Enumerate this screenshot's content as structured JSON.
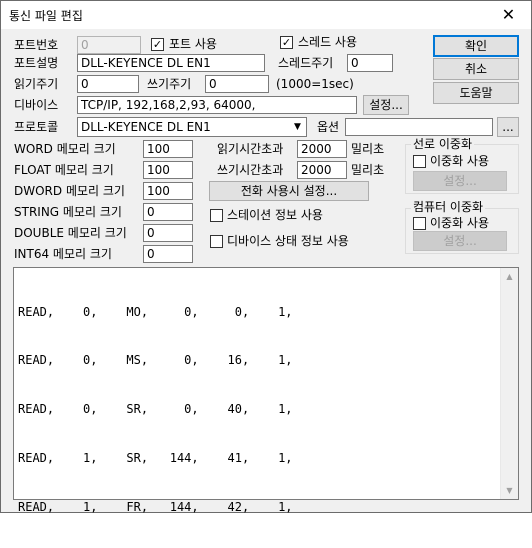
{
  "window": {
    "title": "통신 파일 편집",
    "close_glyph": "✕"
  },
  "port": {
    "number_label": "포트번호",
    "number_value": "0",
    "use_port_label": "포트 사용",
    "use_port_checked": "✓",
    "use_thread_label": "스레드 사용",
    "use_thread_checked": "✓",
    "desc_label": "포트설명",
    "desc_value": "DLL-KEYENCE DL EN1",
    "thread_cycle_label": "스레드주기",
    "thread_cycle_value": "0",
    "read_cycle_label": "읽기주기",
    "read_cycle_value": "0",
    "write_cycle_label": "쓰기주기",
    "write_cycle_value": "0",
    "cycle_note": "(1000=1sec)",
    "device_label": "디바이스",
    "device_value": "TCP/IP, 192,168,2,93, 64000,",
    "device_settings_button": "설정...",
    "protocol_label": "프로토콜",
    "protocol_value": "DLL-KEYENCE DL EN1",
    "options_label": "옵션",
    "options_value": "",
    "options_button": "..."
  },
  "buttons": {
    "ok": "확인",
    "cancel": "취소",
    "help": "도움말"
  },
  "memory": {
    "word_label": "WORD 메모리 크기",
    "word_value": "100",
    "float_label": "FLOAT 메모리 크기",
    "float_value": "100",
    "dword_label": "DWORD 메모리 크기",
    "dword_value": "100",
    "string_label": "STRING 메모리 크기",
    "string_value": "0",
    "double_label": "DOUBLE 메모리 크기",
    "double_value": "0",
    "int64_label": "INT64 메모리 크기",
    "int64_value": "0"
  },
  "timeouts": {
    "read_label": "읽기시간초과",
    "read_value": "2000",
    "read_unit": "밀리초",
    "write_label": "쓰기시간초과",
    "write_value": "2000",
    "write_unit": "밀리초",
    "phone_settings_button": "전화 사용시 설정..."
  },
  "options": {
    "station_info_label": "스테이션 정보 사용",
    "device_status_label": "디바이스 상태 정보 사용"
  },
  "line_redundancy": {
    "title": "선로 이중화",
    "use_label": "이중화 사용",
    "settings_button": "설정..."
  },
  "computer_redundancy": {
    "title": "컴퓨터 이중화",
    "use_label": "이중화 사용",
    "settings_button": "설정..."
  },
  "commands": [
    "READ,    0,    MO,     0,     0,    1,",
    "READ,    0,    MS,     0,    16,    1,",
    "READ,    0,    SR,     0,    40,    1,",
    "READ,    1,    SR,   144,    41,    1,",
    "READ,    1,    FR,   144,    42,    1,"
  ],
  "scrollbar": {
    "up_glyph": "▲",
    "down_glyph": "▼"
  }
}
